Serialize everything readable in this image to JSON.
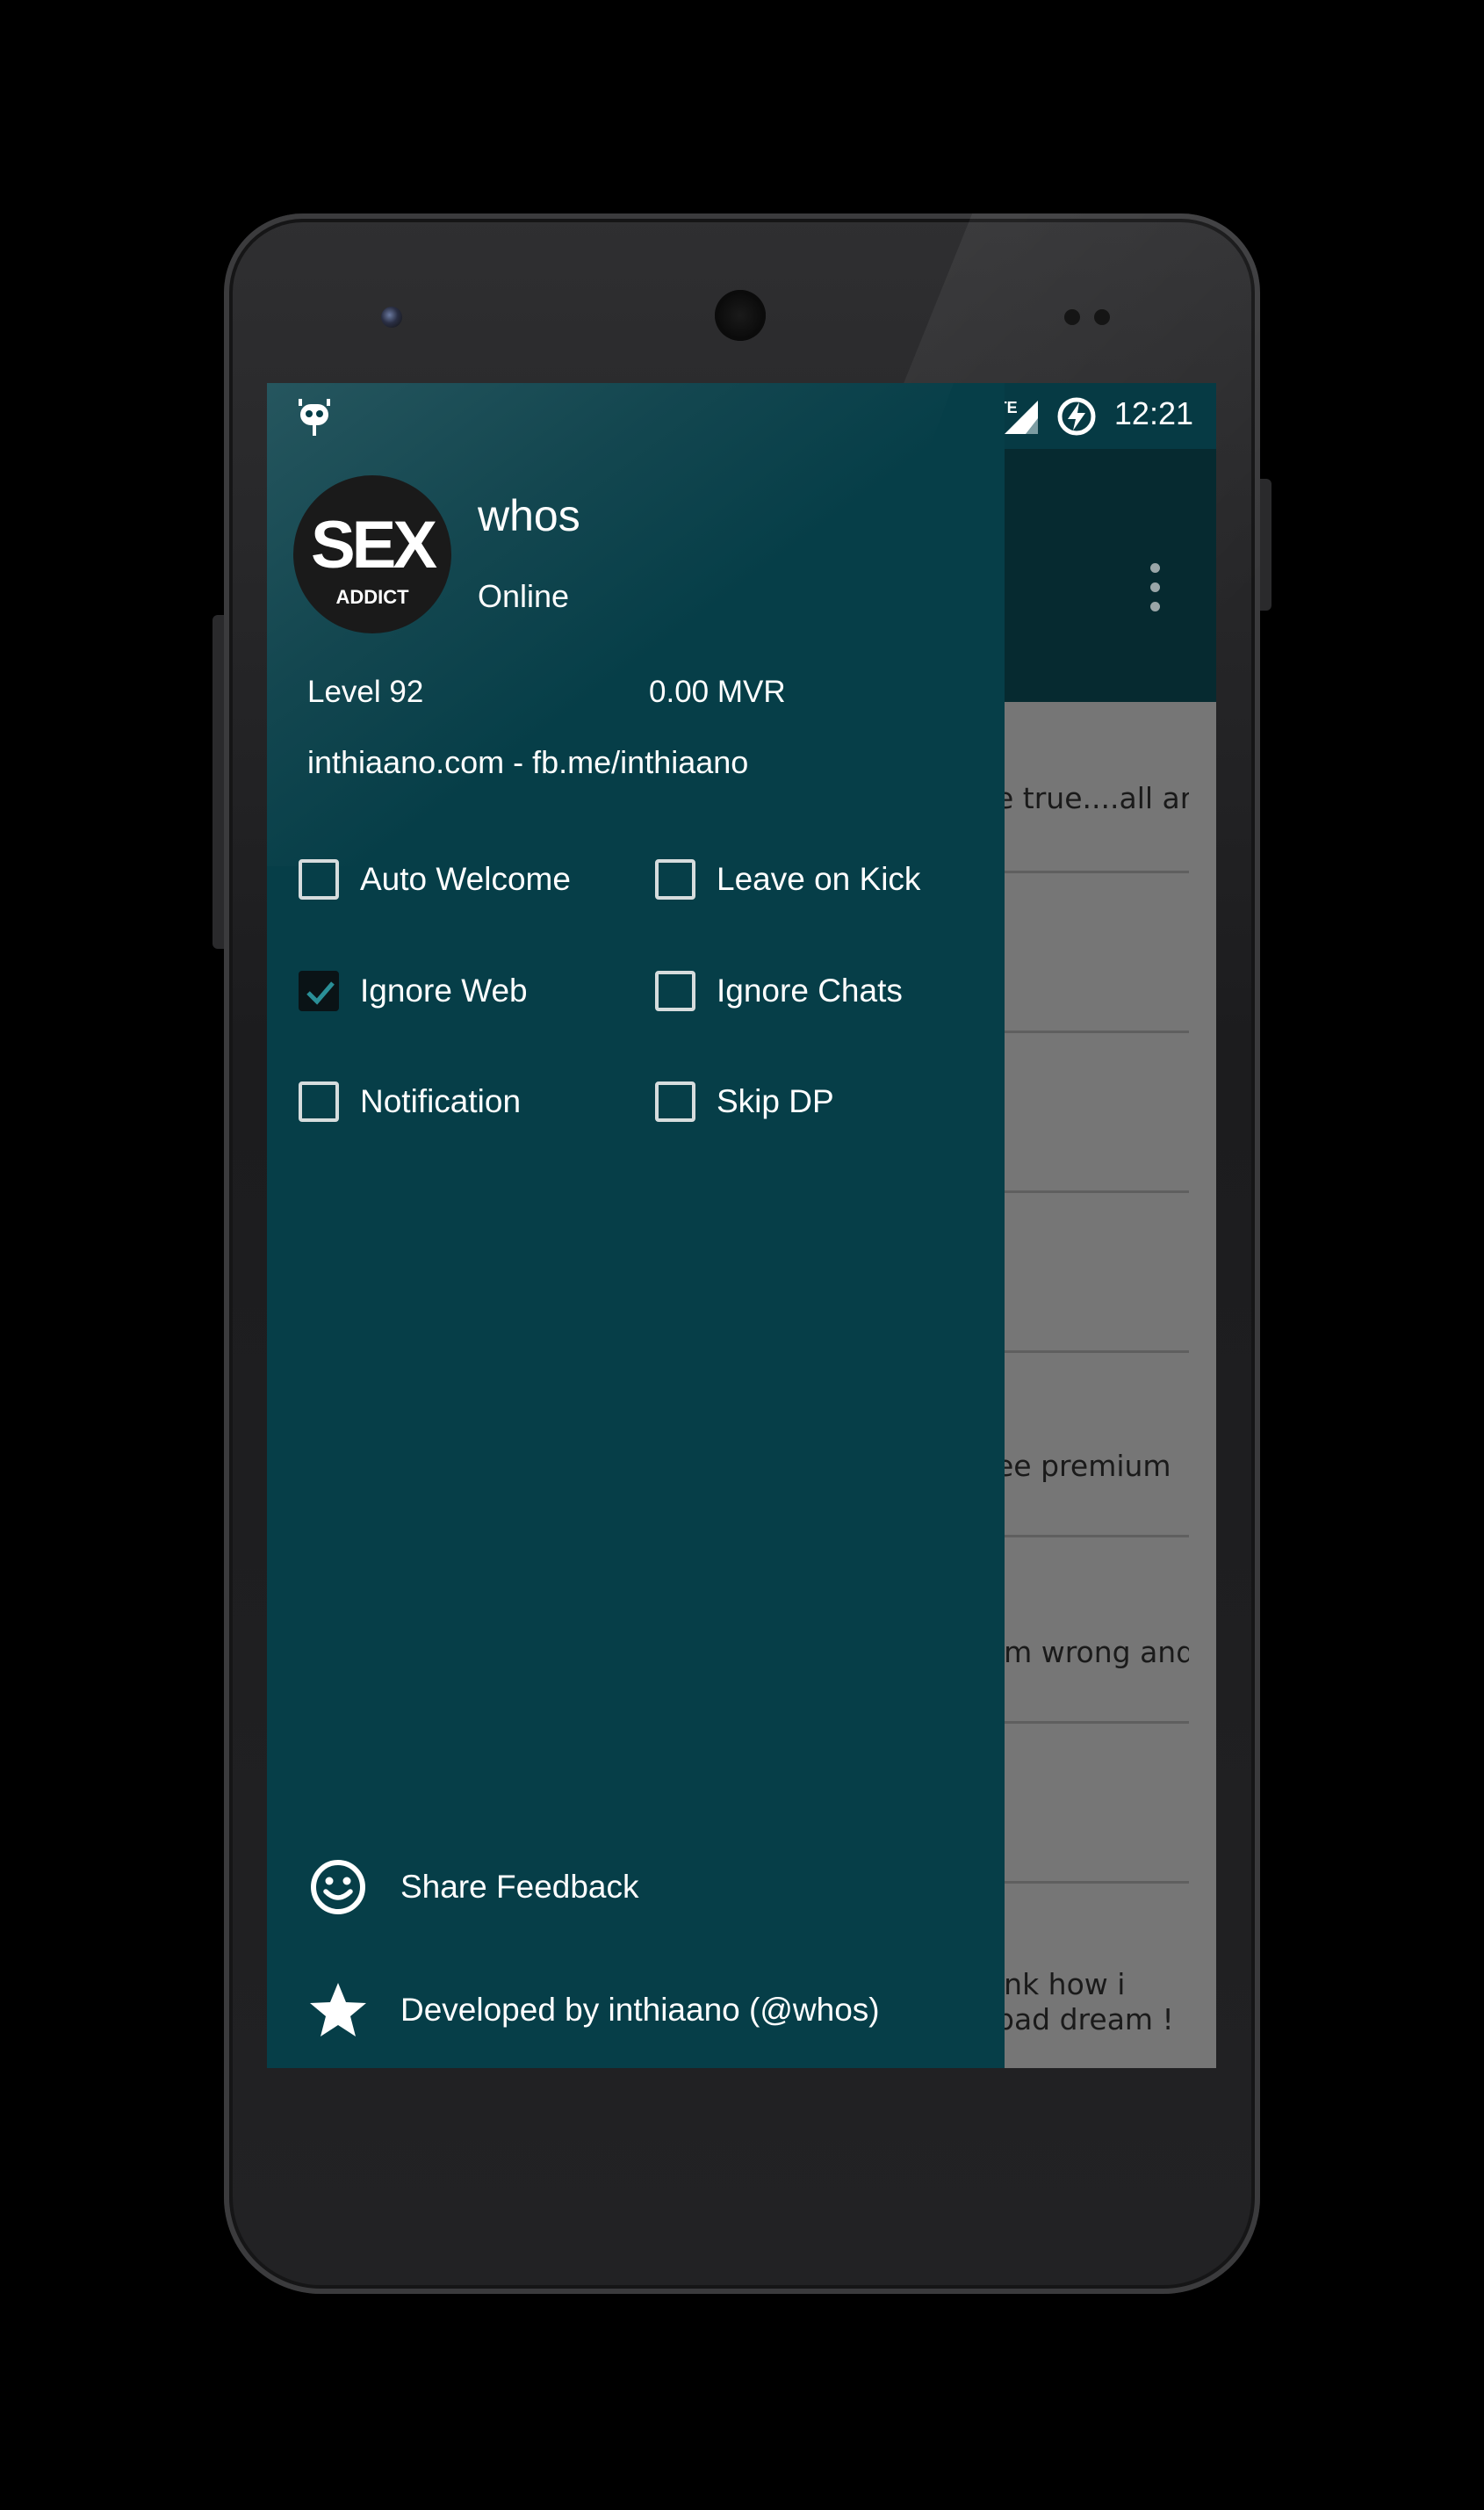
{
  "status_bar": {
    "time": "12:21",
    "network": "LTE"
  },
  "profile": {
    "avatar_text_main": "SEX",
    "avatar_text_sub": "ADDICT",
    "username": "whos",
    "status": "Online",
    "level": "Level 92",
    "balance": "0.00 MVR",
    "site": "inthiaano.com - fb.me/inthiaano"
  },
  "settings": [
    {
      "label": "Auto Welcome",
      "checked": false
    },
    {
      "label": "Leave on Kick",
      "checked": false
    },
    {
      "label": "Ignore Web",
      "checked": true
    },
    {
      "label": "Ignore Chats",
      "checked": false
    },
    {
      "label": "Notification",
      "checked": false
    },
    {
      "label": "Skip DP",
      "checked": false
    }
  ],
  "footer": {
    "feedback_label": "Share Feedback",
    "developer_label": "Developed by inthiaano (@whos)"
  },
  "background_chat": {
    "items": [
      {
        "text": "e true....all are"
      },
      {
        "text": "ee premium"
      },
      {
        "text": "'m wrong and"
      },
      {
        "text": "ink how i"
      },
      {
        "text": "bad dream !"
      }
    ]
  },
  "colors": {
    "drawer": "#063e48",
    "status_bar": "#063a44",
    "toolbar": "#062a30",
    "chat_background": "#767676"
  },
  "icons": {
    "status_left": "android-icon",
    "network": "lte-signal-icon",
    "battery": "battery-charging-icon",
    "overflow": "overflow-menu-icon",
    "feedback": "smiley-icon",
    "developer": "star-icon",
    "checkmark": "checkmark-icon"
  }
}
